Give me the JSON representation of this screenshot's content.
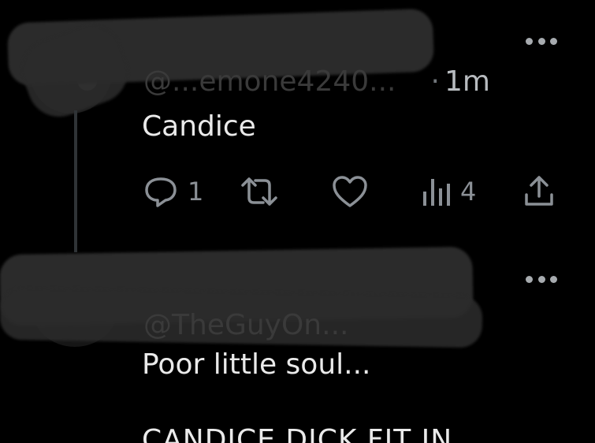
{
  "tweets": [
    {
      "handle": "@...emone4240...",
      "time": "1m",
      "text": "Candice",
      "actions": {
        "reply_count": "1",
        "retweet_count": "",
        "like_count": "",
        "views_count": "4"
      },
      "icons": [
        "reply-icon",
        "retweet-icon",
        "like-icon",
        "views-icon",
        "share-icon",
        "more-icon"
      ]
    },
    {
      "handle": "@TheGuyOn...",
      "text_line_1": "Poor little soul...",
      "text_line_2": "CANDICE DICK FIT IN",
      "icons": [
        "more-icon"
      ]
    }
  ],
  "colors": {
    "background": "#000000",
    "text": "#e7e9ea",
    "secondary": "#71767b",
    "thread_line": "#2f3336"
  }
}
